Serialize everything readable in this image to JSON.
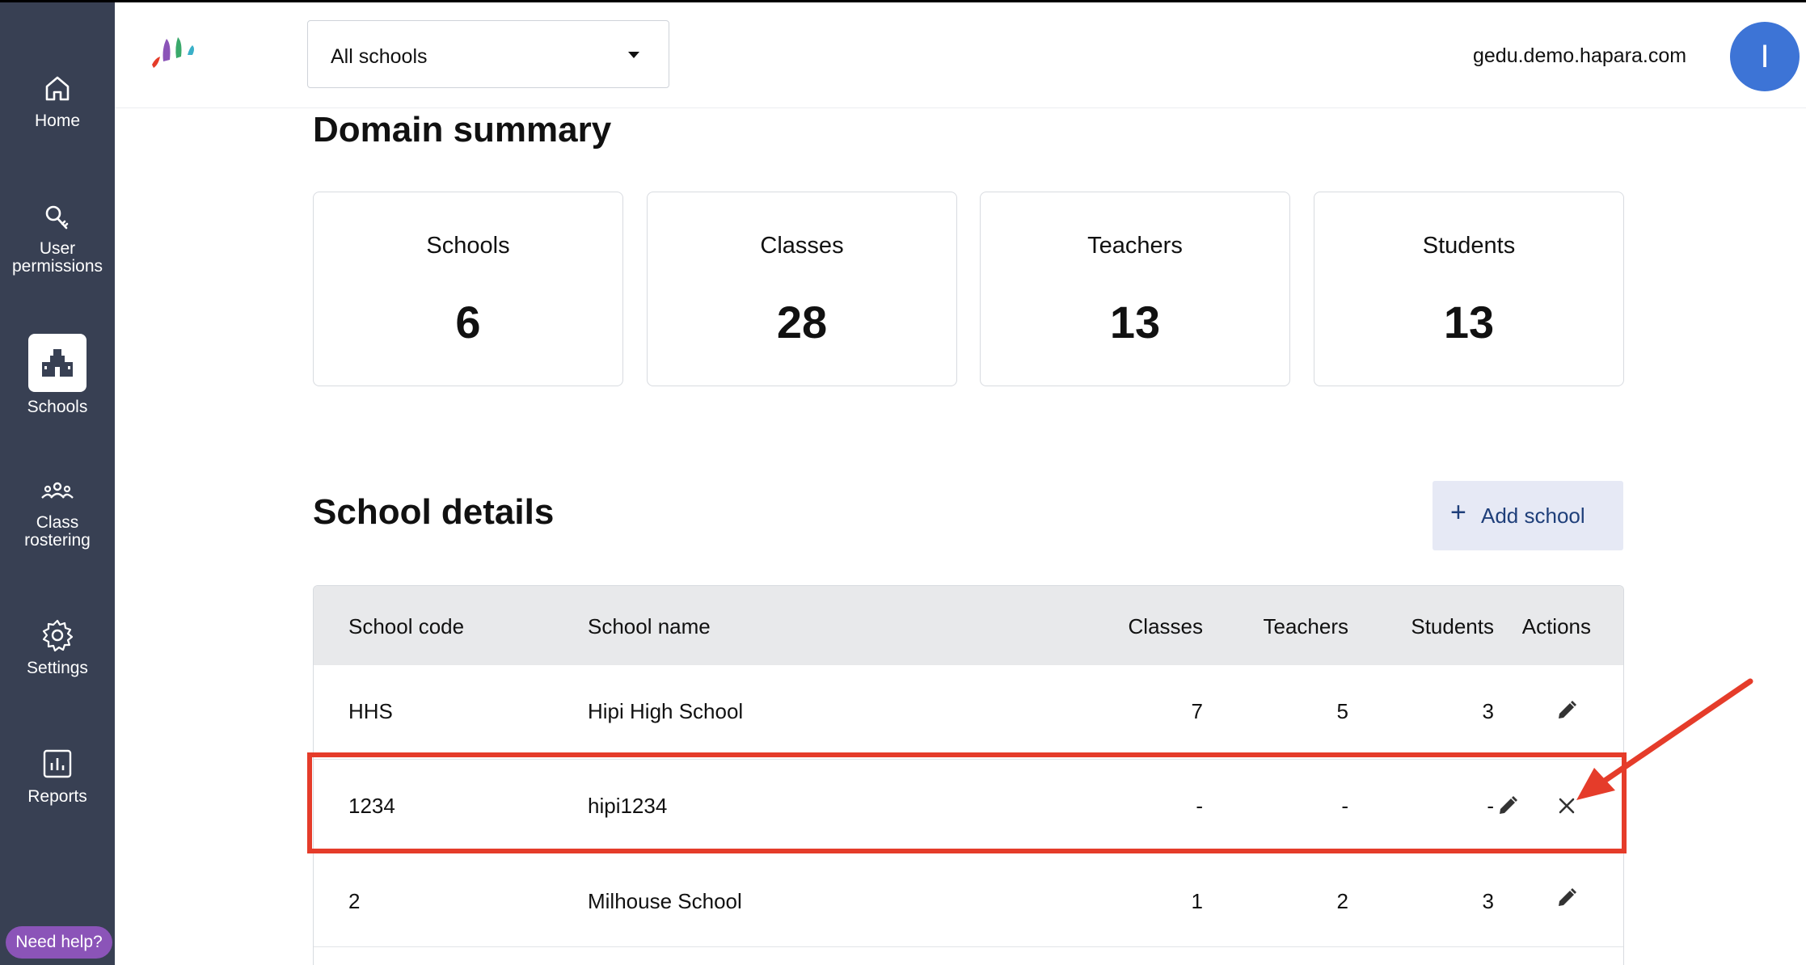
{
  "sidebar": {
    "items": [
      {
        "label": "Home",
        "icon": "home-icon"
      },
      {
        "label": "User\npermissions",
        "icon": "key-icon"
      },
      {
        "label": "Schools",
        "icon": "school-icon",
        "active": true
      },
      {
        "label": "Class\nrostering",
        "icon": "people-icon"
      },
      {
        "label": "Settings",
        "icon": "gear-icon"
      },
      {
        "label": "Reports",
        "icon": "chart-icon"
      }
    ],
    "help": "Need help?"
  },
  "header": {
    "school_select": "All schools",
    "domain": "gedu.demo.hapara.com",
    "avatar_letter": "I"
  },
  "summary": {
    "title": "Domain summary",
    "cards": [
      {
        "label": "Schools",
        "value": "6"
      },
      {
        "label": "Classes",
        "value": "28"
      },
      {
        "label": "Teachers",
        "value": "13"
      },
      {
        "label": "Students",
        "value": "13"
      }
    ]
  },
  "details": {
    "title": "School details",
    "add_label": "Add school",
    "columns": [
      "School code",
      "School name",
      "Classes",
      "Teachers",
      "Students",
      "Actions"
    ],
    "rows": [
      {
        "code": "HHS",
        "name": "Hipi High School",
        "classes": "7",
        "teachers": "5",
        "students": "3"
      },
      {
        "code": "1234",
        "name": "hipi1234",
        "classes": "-",
        "teachers": "-",
        "students": "-"
      },
      {
        "code": "2",
        "name": "Milhouse School",
        "classes": "1",
        "teachers": "2",
        "students": "3"
      }
    ]
  },
  "colors": {
    "sidebar": "#384053",
    "accent": "#3d74d6",
    "help": "#8b54b8",
    "annotation": "#e53c2a"
  }
}
